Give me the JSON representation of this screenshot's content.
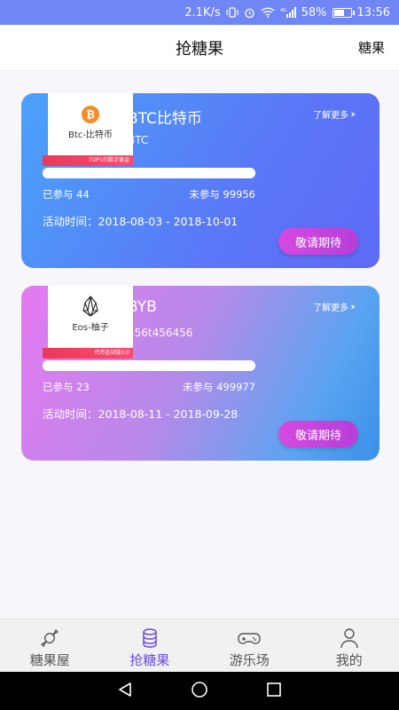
{
  "status_bar": {
    "speed": "2.1K/s",
    "network": "4G",
    "battery": "58%",
    "time": "13:56"
  },
  "header": {
    "title": "抢糖果",
    "right_link": "糖果"
  },
  "cards": [
    {
      "thumb_name": "Btc-比特币",
      "thumb_ribbon": "TOP1的数字黄金",
      "thumb_logo_symbol": "₿",
      "thumb_logo_color": "#f28f2c",
      "title": "BTC比特币",
      "subtitle": "BTC",
      "learn_more": "了解更多",
      "joined": "已参与 44",
      "not_joined": "未参与 99956",
      "time": "活动时间：2018-08-03 - 2018-10-01",
      "button": "敬请期待"
    },
    {
      "thumb_name": "Eos-柚子",
      "thumb_ribbon": "代币区块链3.0",
      "thumb_logo_symbol": "eos-icon",
      "thumb_logo_color": "#222222",
      "title": "BYB",
      "subtitle": "456t456456",
      "learn_more": "了解更多",
      "joined": "已参与 23",
      "not_joined": "未参与 499977",
      "time": "活动时间：2018-08-11 - 2018-09-28",
      "button": "敬请期待"
    }
  ],
  "bottom_nav": {
    "items": [
      {
        "label": "糖果屋",
        "icon": "candy-icon",
        "active": false
      },
      {
        "label": "抢糖果",
        "icon": "database-icon",
        "active": true
      },
      {
        "label": "游乐场",
        "icon": "gamepad-icon",
        "active": false
      },
      {
        "label": "我的",
        "icon": "user-icon",
        "active": false
      }
    ]
  },
  "colors": {
    "accent": "#6a4ce0",
    "button": "#c945dd"
  }
}
